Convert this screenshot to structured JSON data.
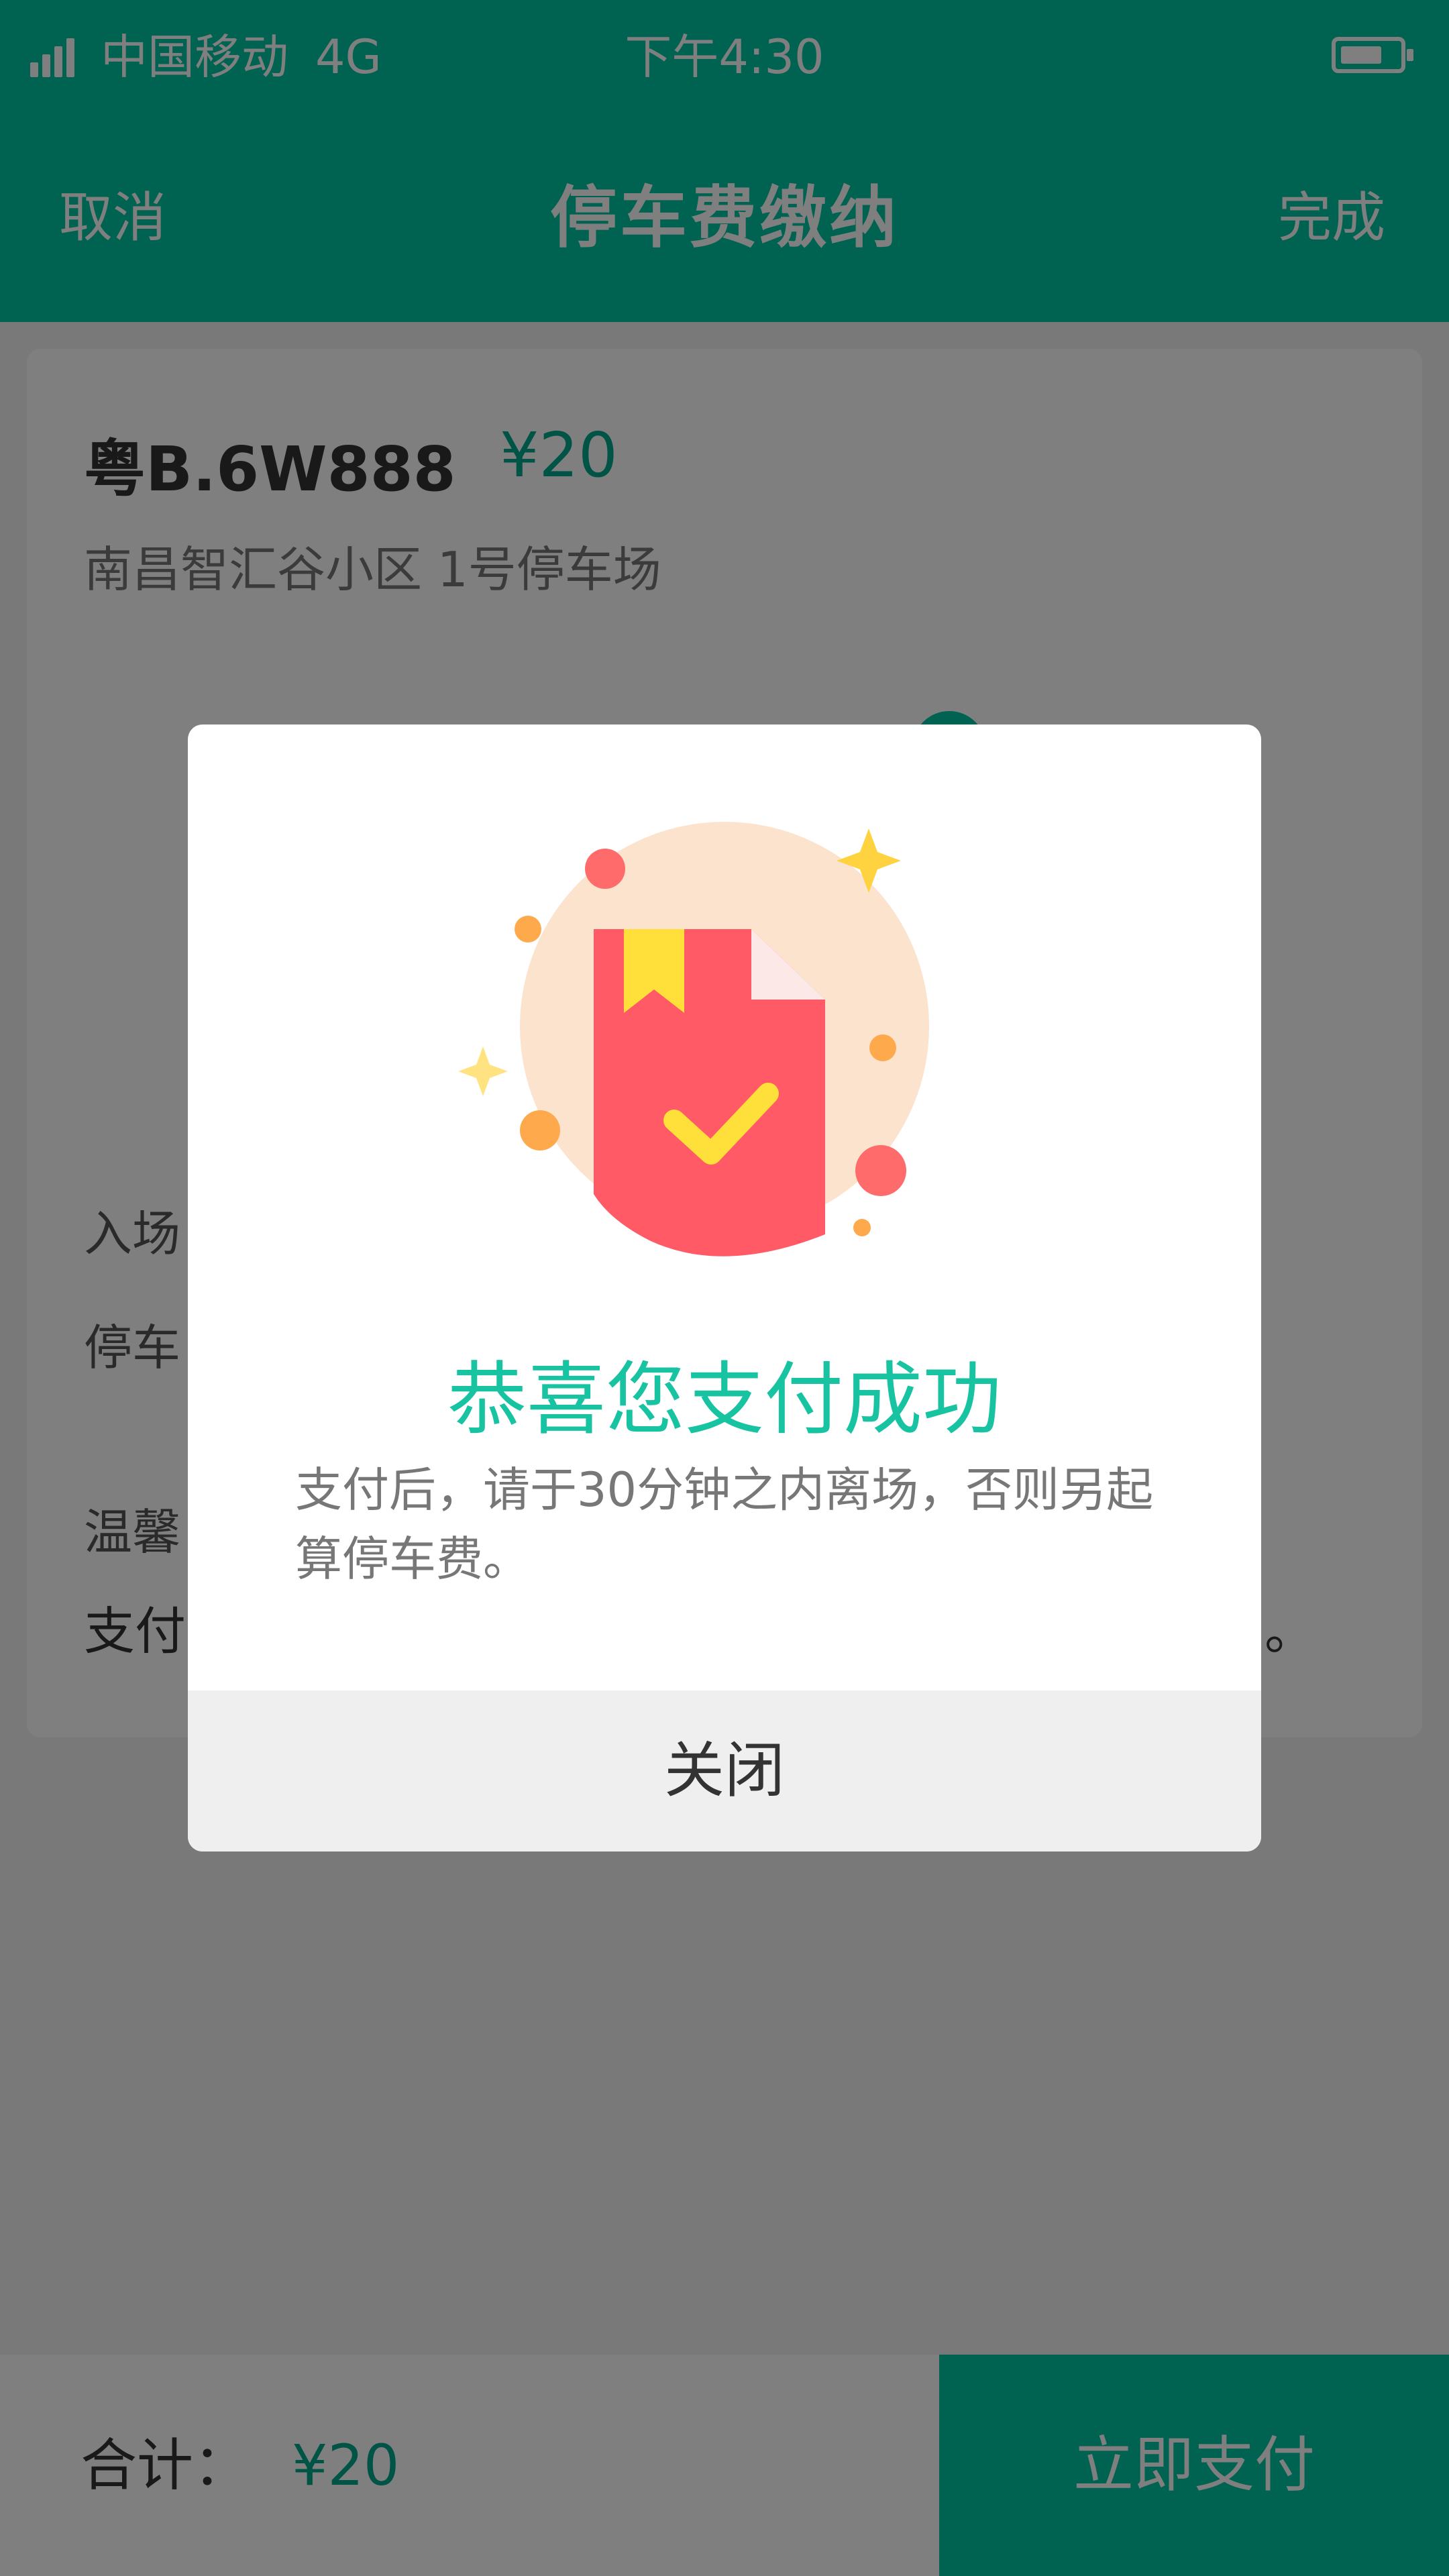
{
  "status_bar": {
    "carrier": "中国移动",
    "network": "4G",
    "time": "下午4:30"
  },
  "nav": {
    "cancel_label": "取消",
    "title": "停车费缴纳",
    "done_label": "完成"
  },
  "ticket": {
    "plate": "粤B.6W888",
    "price": "¥20",
    "lot": "南昌智汇谷小区   1号停车场",
    "entry_label_partial": "入场",
    "duration_label_partial": "停车",
    "tip_label_partial": "温馨",
    "tip_text_partial": "支付",
    "tip_text_end": "。"
  },
  "bottom": {
    "total_label": "合计：",
    "total_value": "¥20",
    "pay_label": "立即支付"
  },
  "modal": {
    "title": "恭喜您支付成功",
    "message": "支付后，请于30分钟之内离场，否则另起算停车费。",
    "close_label": "关闭"
  },
  "colors": {
    "brand": "#00c4a0",
    "price": "#00a98c",
    "modal_title": "#18c3a1",
    "illus_circle": "#fbe3cd",
    "illus_doc": "#ff5a66",
    "illus_bookmark": "#ffe03a"
  },
  "icons": {
    "signal": "signal-icon",
    "battery": "battery-icon",
    "success_illustration": "payment-success-illustration"
  }
}
